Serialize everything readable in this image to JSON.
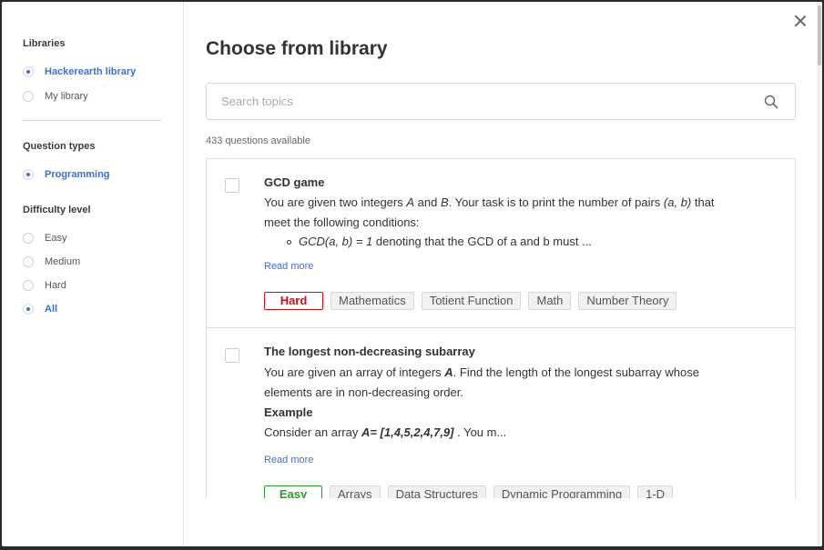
{
  "sidebar": {
    "libraries_title": "Libraries",
    "libraries": [
      {
        "label": "Hackerearth library",
        "selected": true
      },
      {
        "label": "My library",
        "selected": false
      }
    ],
    "question_types_title": "Question types",
    "question_types": [
      {
        "label": "Programming",
        "selected": true
      }
    ],
    "difficulty_title": "Difficulty level",
    "difficulty": [
      {
        "label": "Easy",
        "selected": false
      },
      {
        "label": "Medium",
        "selected": false
      },
      {
        "label": "Hard",
        "selected": false
      },
      {
        "label": "All",
        "selected": true
      }
    ]
  },
  "main": {
    "title": "Choose from library",
    "search_placeholder": "Search topics",
    "count": "433 questions available",
    "read_more": "Read more",
    "questions": [
      {
        "title": "GCD game",
        "line1_a": "You are given two integers ",
        "var_a": "A",
        "line1_b": " and ",
        "var_b": "B",
        "line1_c": ". Your task is to print the number of pairs ",
        "var_pair": "(a, b)",
        "line1_d": " that",
        "line2": "meet the following conditions:",
        "bullet_expr": "GCD(a, b) = 1",
        "bullet_text": " denoting that the GCD of a and b must ...",
        "difficulty": "Hard",
        "tags": [
          "Mathematics",
          "Totient Function",
          "Math",
          "Number Theory"
        ]
      },
      {
        "title": "The longest non-decreasing subarray",
        "line1_a": "You are given an array of integers ",
        "var_a": "A",
        "line1_b": ". Find the length of the longest subarray whose",
        "line2": "elements are in non-decreasing order.",
        "example_label": "Example",
        "line3_a": "Consider an array ",
        "var_arr": "A= [1,4,5,2,4,7,9]",
        "line3_b": " . You m...",
        "difficulty": "Easy",
        "tags": [
          "Arrays",
          "Data Structures",
          "Dynamic Programming",
          "1-D"
        ]
      }
    ]
  },
  "colors": {
    "accent": "#3c6fd6",
    "hard": "#c0141a",
    "easy": "#2c9a2c"
  }
}
